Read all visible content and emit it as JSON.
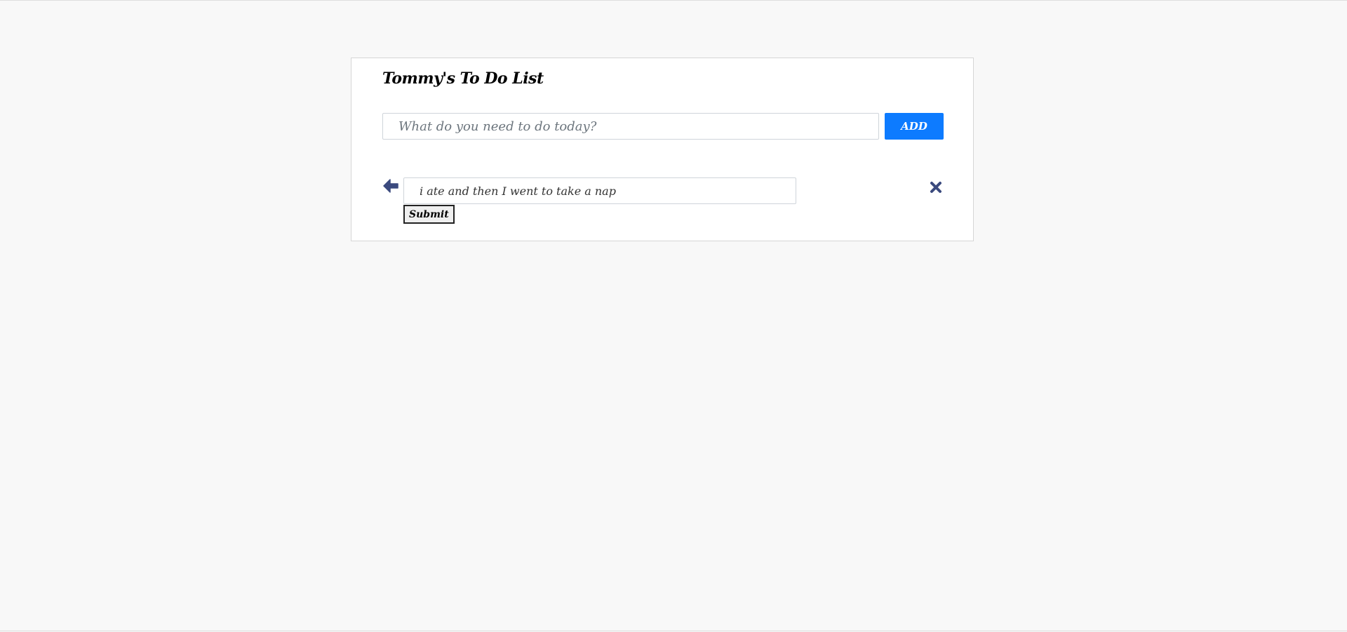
{
  "app": {
    "title": "Tommy's To Do List"
  },
  "new_todo": {
    "placeholder": "What do you need to do today?",
    "value": "",
    "add_label": "ADD"
  },
  "todos": [
    {
      "text": "i ate and then I went to take a nap",
      "submit_label": "Submit",
      "back_icon": "arrow-left-icon",
      "delete_icon": "close-icon"
    }
  ],
  "colors": {
    "page_bg": "#f8f8f8",
    "card_bg": "#ffffff",
    "accent": "#0d7bff",
    "icon": "#3b4a7e"
  }
}
